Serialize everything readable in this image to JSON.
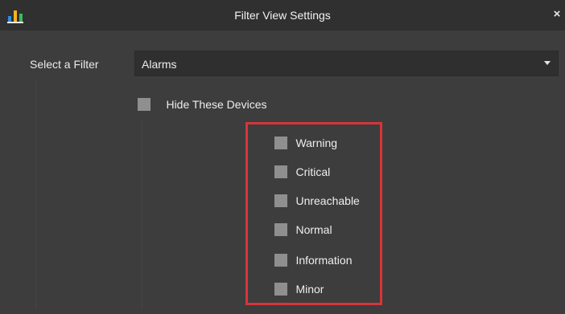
{
  "window": {
    "title": "Filter View Settings",
    "close_label": "×"
  },
  "filter": {
    "label": "Select a Filter",
    "selected": "Alarms"
  },
  "hide_devices": {
    "label": "Hide These Devices",
    "checked": false
  },
  "options": [
    {
      "label": "Warning",
      "checked": false
    },
    {
      "label": "Critical",
      "checked": false
    },
    {
      "label": "Unreachable",
      "checked": false
    },
    {
      "label": "Normal",
      "checked": false
    },
    {
      "label": "Information",
      "checked": false
    },
    {
      "label": "Minor",
      "checked": false
    }
  ],
  "colors": {
    "dialog_bg": "#3d3d3d",
    "titlebar_bg": "#303030",
    "checkbox": "#8f8f8f",
    "highlight_border": "#d6353b",
    "icon_bars": [
      "#2e8ce0",
      "#f2b51f",
      "#3dbb5a"
    ]
  },
  "icons": {
    "app": "bar-chart-icon",
    "close": "close-icon",
    "dropdown": "chevron-down-icon"
  }
}
